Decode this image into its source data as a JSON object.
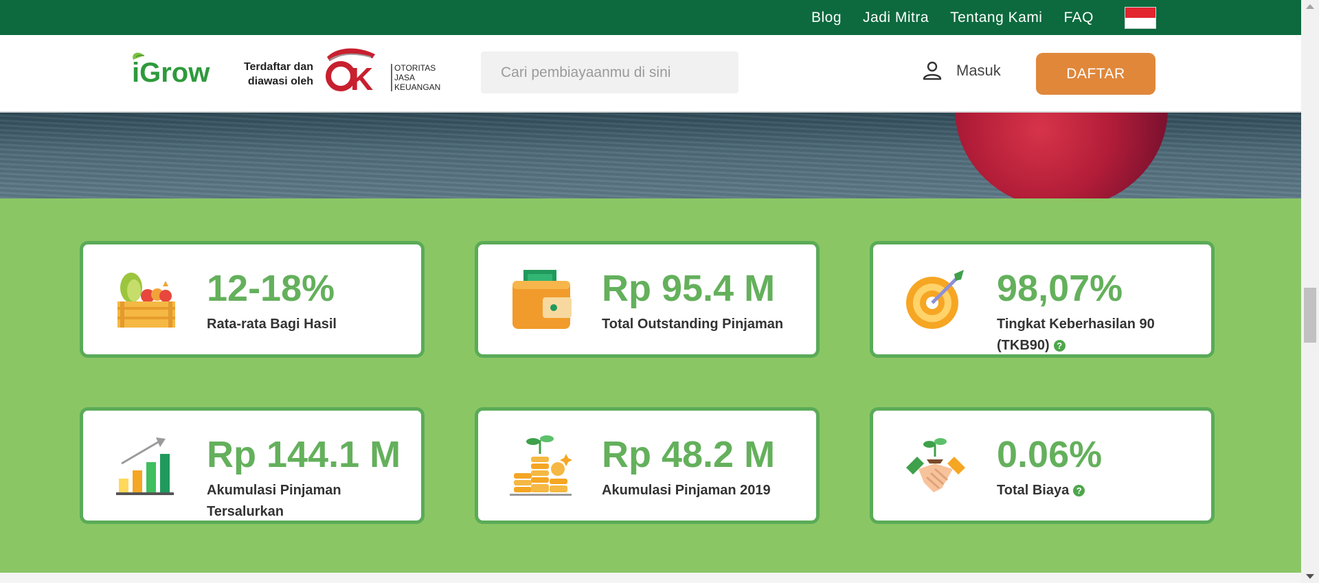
{
  "topnav": {
    "links": [
      "Blog",
      "Jadi Mitra",
      "Tentang Kami",
      "FAQ"
    ]
  },
  "header": {
    "logo_text": "iGrow",
    "registered_line1": "Terdaftar dan",
    "registered_line2": "diawasi oleh",
    "ojk_text": [
      "OTORITAS",
      "JASA",
      "KEUANGAN"
    ],
    "search_placeholder": "Cari pembiayaanmu di sini",
    "login_label": "Masuk",
    "register_label": "DAFTAR"
  },
  "stats": [
    {
      "icon": "fruit-crate-icon",
      "value": "12-18%",
      "label": "Rata-rata Bagi Hasil",
      "help": false
    },
    {
      "icon": "wallet-icon",
      "value": "Rp 95.4 M",
      "label": "Total Outstanding Pinjaman",
      "help": false
    },
    {
      "icon": "target-icon",
      "value": "98,07%",
      "label": "Tingkat Keberhasilan 90 (TKB90)",
      "help": true
    },
    {
      "icon": "growth-chart-icon",
      "value": "Rp 144.1 M",
      "label": "Akumulasi Pinjaman Tersalurkan",
      "help": false
    },
    {
      "icon": "coins-plant-icon",
      "value": "Rp 48.2 M",
      "label": "Akumulasi Pinjaman 2019",
      "help": false
    },
    {
      "icon": "handshake-icon",
      "value": "0.06%",
      "label": "Total Biaya",
      "help": true
    }
  ],
  "colors": {
    "topbar": "#0c6a3e",
    "stats_bg": "#8bc665",
    "card_border": "#5aab57",
    "value_green": "#64b05c",
    "cta_orange": "#e0873a"
  }
}
